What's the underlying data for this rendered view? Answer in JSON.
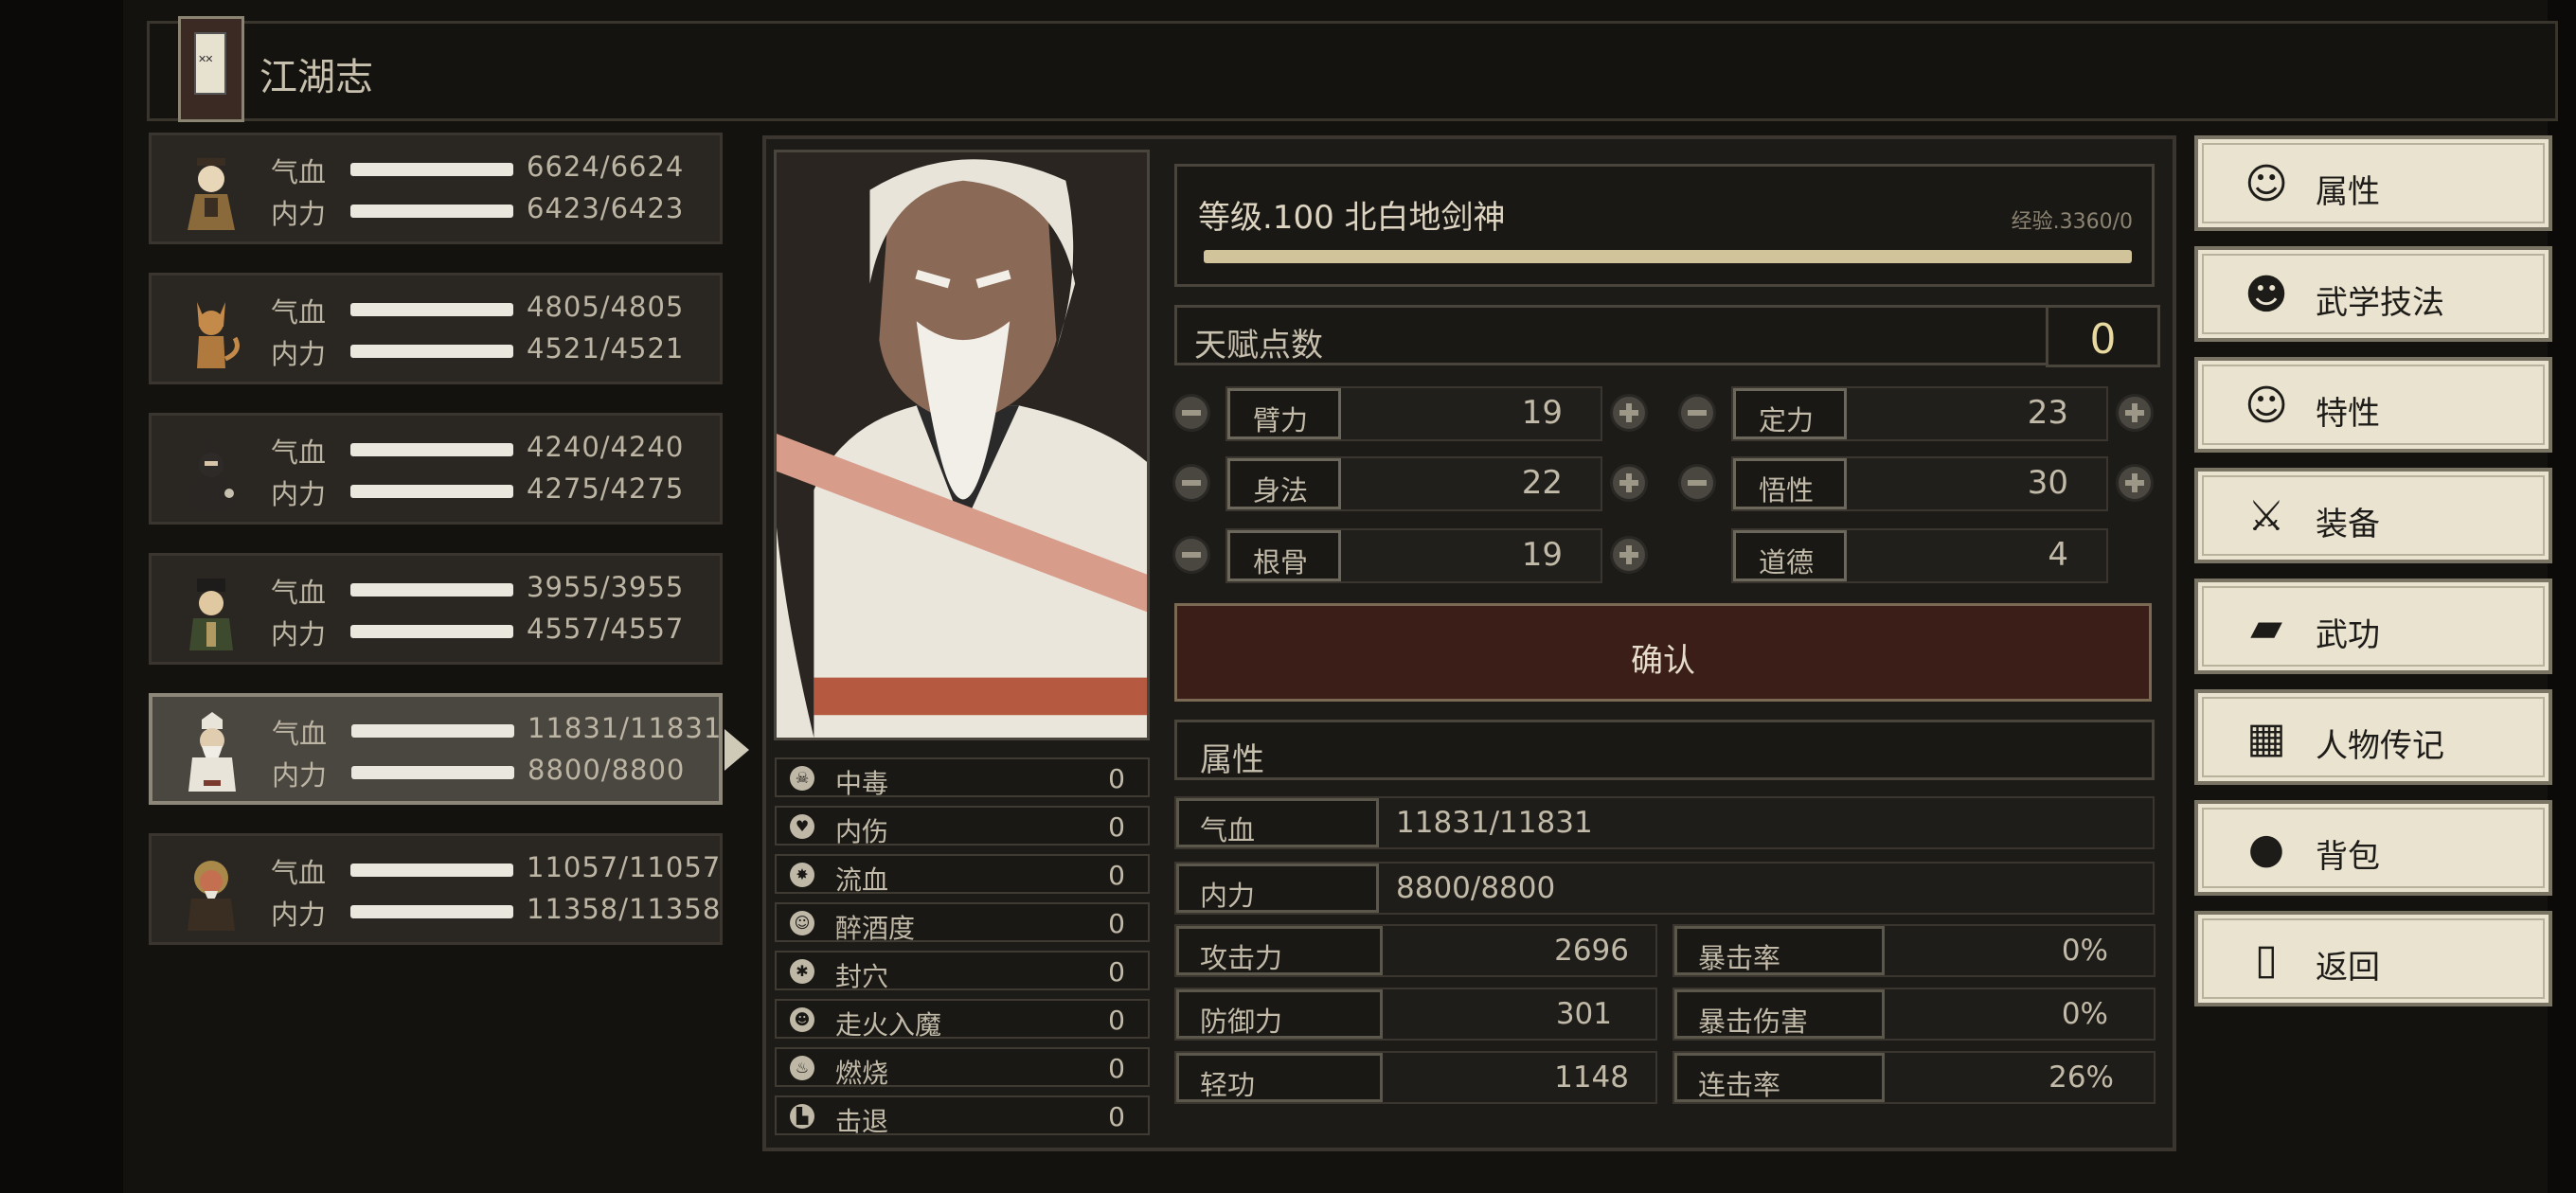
{
  "header": {
    "title": "江湖志"
  },
  "party": [
    {
      "hp_label": "气血",
      "mp_label": "内力",
      "hp": "6624/6624",
      "mp": "6423/6423"
    },
    {
      "hp_label": "气血",
      "mp_label": "内力",
      "hp": "4805/4805",
      "mp": "4521/4521"
    },
    {
      "hp_label": "气血",
      "mp_label": "内力",
      "hp": "4240/4240",
      "mp": "4275/4275"
    },
    {
      "hp_label": "气血",
      "mp_label": "内力",
      "hp": "3955/3955",
      "mp": "4557/4557"
    },
    {
      "hp_label": "气血",
      "mp_label": "内力",
      "hp": "11831/11831",
      "mp": "8800/8800"
    },
    {
      "hp_label": "气血",
      "mp_label": "内力",
      "hp": "11057/11057",
      "mp": "11358/11358"
    }
  ],
  "status_effects": [
    {
      "label": "中毒",
      "value": "0",
      "icon": "skull-icon"
    },
    {
      "label": "内伤",
      "value": "0",
      "icon": "broken-heart-icon"
    },
    {
      "label": "流血",
      "value": "0",
      "icon": "blood-icon"
    },
    {
      "label": "醉酒度",
      "value": "0",
      "icon": "drunk-icon"
    },
    {
      "label": "封穴",
      "value": "0",
      "icon": "seal-icon"
    },
    {
      "label": "走火入魔",
      "value": "0",
      "icon": "demon-icon"
    },
    {
      "label": "燃烧",
      "value": "0",
      "icon": "fire-icon"
    },
    {
      "label": "击退",
      "value": "0",
      "icon": "knockback-icon"
    }
  ],
  "character": {
    "level_title": "等级.100 北白地剑神",
    "exp": "经验.3360/0",
    "talent_label": "天赋点数",
    "talent_points": "0"
  },
  "attributes": {
    "strength": {
      "label": "臂力",
      "value": "19"
    },
    "focus": {
      "label": "定力",
      "value": "23"
    },
    "agility": {
      "label": "身法",
      "value": "22"
    },
    "insight": {
      "label": "悟性",
      "value": "30"
    },
    "constitution": {
      "label": "根骨",
      "value": "19"
    },
    "morality": {
      "label": "道德",
      "value": "4"
    }
  },
  "confirm_label": "确认",
  "properties": {
    "title": "属性",
    "hp": {
      "label": "气血",
      "value": "11831/11831"
    },
    "mp": {
      "label": "内力",
      "value": "8800/8800"
    },
    "attack": {
      "label": "攻击力",
      "value": "2696"
    },
    "crit_rate": {
      "label": "暴击率",
      "value": "0%"
    },
    "defense": {
      "label": "防御力",
      "value": "301"
    },
    "crit_damage": {
      "label": "暴击伤害",
      "value": "0%"
    },
    "lightness": {
      "label": "轻功",
      "value": "1148"
    },
    "combo_rate": {
      "label": "连击率",
      "value": "26%"
    }
  },
  "menu": [
    {
      "label": "属性",
      "icon": "character-icon"
    },
    {
      "label": "武学技法",
      "icon": "martial-skill-icon"
    },
    {
      "label": "特性",
      "icon": "trait-icon"
    },
    {
      "label": "装备",
      "icon": "sword-icon"
    },
    {
      "label": "武功",
      "icon": "scroll-icon"
    },
    {
      "label": "人物传记",
      "icon": "biography-icon"
    },
    {
      "label": "背包",
      "icon": "bag-icon"
    },
    {
      "label": "返回",
      "icon": "door-icon"
    }
  ]
}
